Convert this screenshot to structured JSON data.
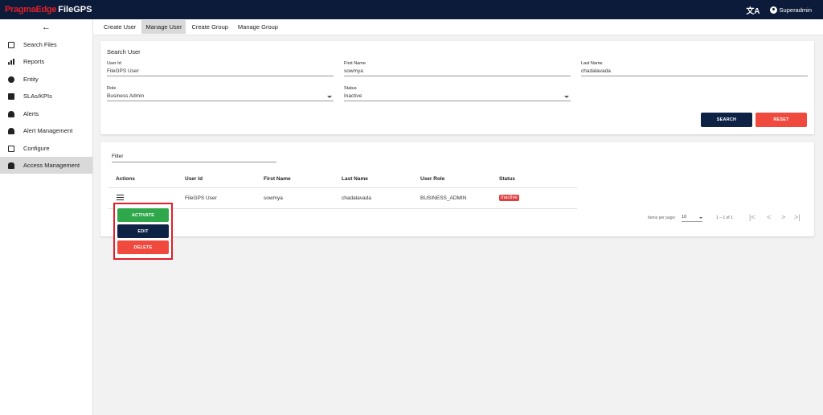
{
  "brand": {
    "name_red": "PragmaEdge",
    "name_white": "FileGPS"
  },
  "header": {
    "translate_icon": "translate-icon",
    "user": "Superadmin"
  },
  "sidebar": {
    "back_icon": "←",
    "items": [
      {
        "label": "Search Files",
        "icon": "file-icon"
      },
      {
        "label": "Reports",
        "icon": "bar-chart-icon"
      },
      {
        "label": "Entity",
        "icon": "entity-icon"
      },
      {
        "label": "SLAs/KPIs",
        "icon": "document-icon"
      },
      {
        "label": "Alerts",
        "icon": "bell-icon"
      },
      {
        "label": "Alert Management",
        "icon": "bell-icon"
      },
      {
        "label": "Configure",
        "icon": "config-icon"
      },
      {
        "label": "Access Management",
        "icon": "people-icon",
        "active": true
      }
    ]
  },
  "tabs": [
    {
      "label": "Create User"
    },
    {
      "label": "Manage User",
      "active": true
    },
    {
      "label": "Create Group"
    },
    {
      "label": "Manage Group"
    }
  ],
  "search": {
    "title": "Search User",
    "user_id": {
      "label": "User Id",
      "value": "FileGPS User"
    },
    "first_name": {
      "label": "First Name",
      "value": "sowmya"
    },
    "last_name": {
      "label": "Last Name",
      "value": "chadalavada"
    },
    "role": {
      "label": "Role",
      "value": "Business Admin"
    },
    "status": {
      "label": "Status",
      "value": "Inactive"
    },
    "search_btn": "SEARCH",
    "reset_btn": "RESET"
  },
  "table": {
    "filter_label": "Filter",
    "headers": [
      "Actions",
      "User Id",
      "First Name",
      "Last Name",
      "User Role",
      "Status"
    ],
    "rows": [
      {
        "user_id": "FileGPS User",
        "first_name": "sowmya",
        "last_name": "chadalavada",
        "role": "BUSINESS_ADMIN",
        "status": "Inactive"
      }
    ],
    "pager": {
      "items_per_page_label": "Items per page:",
      "page_size": "10",
      "range": "1 – 1 of 1"
    }
  },
  "action_menu": {
    "activate": "ACTIVATE",
    "edit": "EDIT",
    "delete": "DELETE"
  },
  "colors": {
    "navy": "#0d1b3a",
    "brand_red": "#e0202a",
    "green": "#2ea84a",
    "reset_red": "#f04a3e",
    "status_red": "#e04040"
  }
}
